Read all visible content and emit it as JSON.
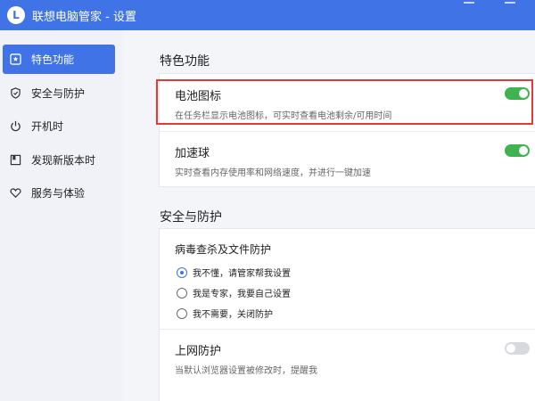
{
  "window": {
    "title": "联想电脑管家 - 设置",
    "logo_letter": "L",
    "controls": [
      "minimize-icon",
      "close-icon"
    ]
  },
  "sidebar": {
    "items": [
      {
        "label": "特色功能",
        "icon": "star-badge-icon",
        "active": true
      },
      {
        "label": "安全与防护",
        "icon": "shield-icon",
        "active": false
      },
      {
        "label": "开机时",
        "icon": "power-icon",
        "active": false
      },
      {
        "label": "发现新版本时",
        "icon": "bookmark-icon",
        "active": false
      },
      {
        "label": "服务与体验",
        "icon": "heart-icon",
        "active": false
      }
    ]
  },
  "colors": {
    "accent": "#3f73e6",
    "toggle_on": "#3eb34f",
    "toggle_off": "#d7d9de",
    "highlight": "#e53935"
  },
  "sections": {
    "featured": {
      "title": "特色功能",
      "battery_icon": {
        "title": "电池图标",
        "desc": "在任务栏显示电池图标，可实时查看电池剩余/可用时间",
        "enabled": true
      },
      "speed_ball": {
        "title": "加速球",
        "desc": "实时查看内存使用率和网络速度，并进行一键加速",
        "enabled": true
      }
    },
    "security": {
      "title": "安全与防护",
      "antivirus": {
        "title": "病毒查杀及文件防护",
        "options": [
          {
            "label": "我不懂，请管家帮我设置",
            "checked": true
          },
          {
            "label": "我是专家，我要自己设置",
            "checked": false
          },
          {
            "label": "我不需要，关闭防护",
            "checked": false
          }
        ]
      },
      "web_protection": {
        "title": "上网防护",
        "desc": "当默认浏览器设置被修改时，提醒我",
        "enabled": false
      }
    }
  }
}
